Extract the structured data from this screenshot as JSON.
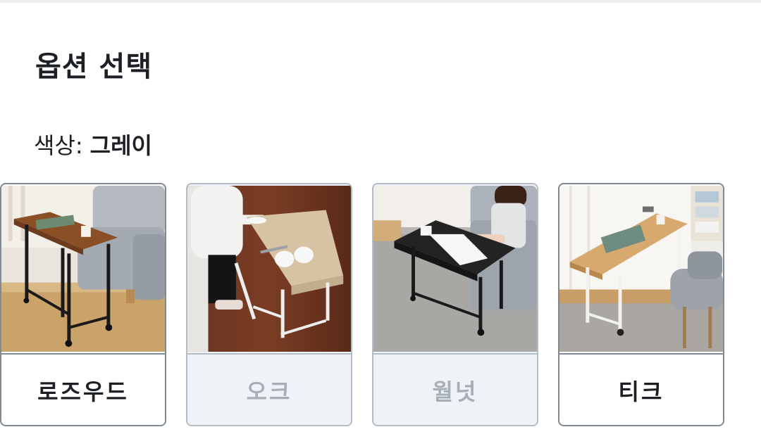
{
  "option_section": {
    "title": "옵션 선택",
    "color_label": "색상:",
    "color_value": "그레이"
  },
  "options": [
    {
      "label": "로즈우드",
      "state": "available",
      "photo": "rosewood-table-photo"
    },
    {
      "label": "오크",
      "state": "disabled",
      "photo": "oak-table-photo"
    },
    {
      "label": "월넛",
      "state": "disabled",
      "photo": "walnut-table-photo"
    },
    {
      "label": "티크",
      "state": "available",
      "photo": "teak-table-photo"
    }
  ],
  "colors": {
    "border_available": "#7f8a95",
    "border_disabled": "#b4bcc5",
    "disabled_bg": "#eff2f6",
    "disabled_text": "#a6aeb7"
  }
}
